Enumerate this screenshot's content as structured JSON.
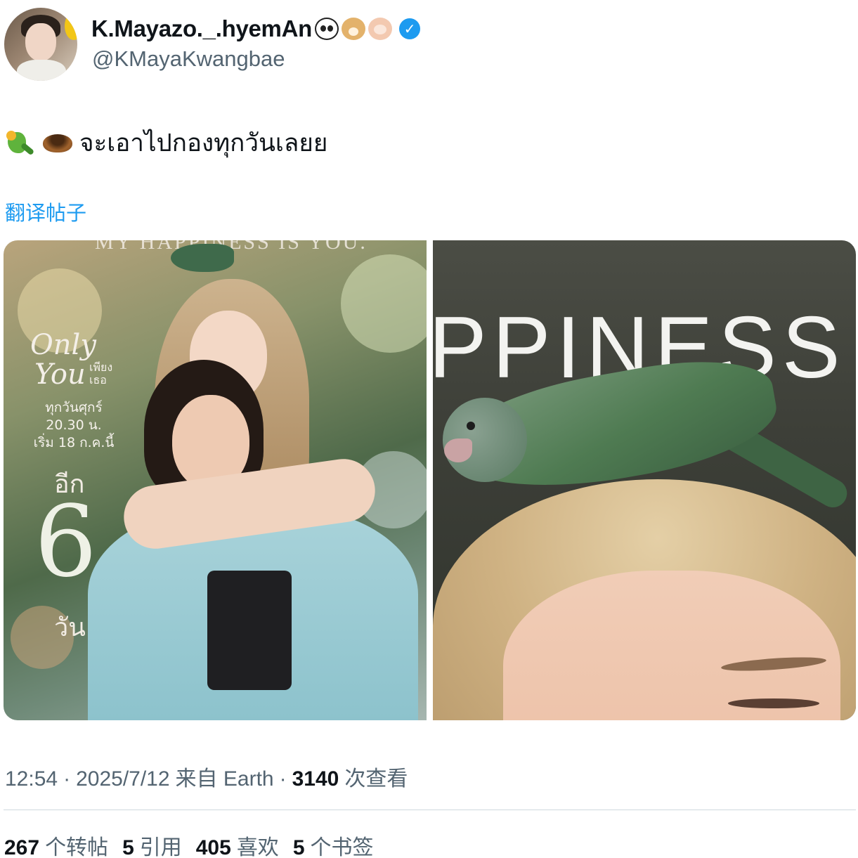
{
  "author": {
    "display_name": "K.Mayazo._.hyemAn",
    "emojis": [
      "panda-face",
      "dog-face",
      "hamster-face"
    ],
    "verified": true,
    "handle": "@KMayaKwangbae"
  },
  "tweet": {
    "emojis": [
      "parrot",
      "nest"
    ],
    "text": "จะเอาไปกองทุกวันเลยย",
    "translate_label": "翻译帖子"
  },
  "media": {
    "left_poster": {
      "top_text": "MY HAPPINESS IS YOU.",
      "logo_only": "Only",
      "logo_you": "You",
      "logo_thai": "เพียงเธอ",
      "schedule_day": "ทุกวันศุกร์",
      "schedule_time": "20.30 น.",
      "schedule_start": "เริ่ม 18 ก.ค.นี้",
      "countdown_label": "อีก",
      "countdown_number": "6",
      "countdown_unit": "วัน"
    },
    "right_zoom": {
      "big_text": "PPINESS I"
    }
  },
  "meta": {
    "time": "12:54",
    "sep1": "·",
    "date": "2025/7/12",
    "source": "来自 Earth",
    "sep2": "·",
    "views_count": "3140",
    "views_label": "次查看"
  },
  "stats": {
    "retweets": {
      "num": "267",
      "label": "个转帖"
    },
    "quotes": {
      "num": "5",
      "label": "引用"
    },
    "likes": {
      "num": "405",
      "label": "喜欢"
    },
    "bookmarks": {
      "num": "5",
      "label": "个书签"
    }
  },
  "colors": {
    "accent": "#1d9bf0",
    "secondary_text": "#536471",
    "primary_text": "#0f1419"
  }
}
